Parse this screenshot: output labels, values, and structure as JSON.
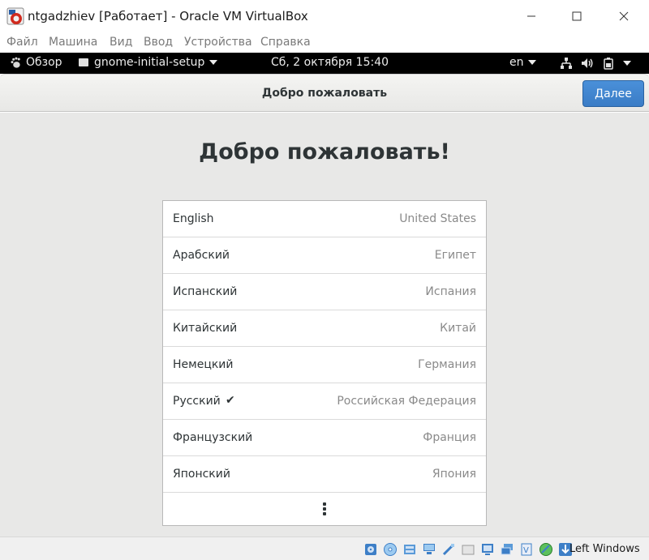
{
  "window": {
    "title": "ntgadzhiev [Работает] - Oracle VM VirtualBox"
  },
  "vbox_menu": {
    "items": [
      "Файл",
      "Машина",
      "Вид",
      "Ввод",
      "Устройства",
      "Справка"
    ]
  },
  "gnome_topbar": {
    "activities_label": "Обзор",
    "app_label": "gnome-initial-setup",
    "clock": "Сб, 2 октября  15:40",
    "input_language": "en"
  },
  "header": {
    "title": "Добро пожаловать",
    "next_label": "Далее",
    "accent_color": "#3a7cc6"
  },
  "main": {
    "welcome_heading": "Добро пожаловать!",
    "languages": [
      {
        "name": "English",
        "region": "United States",
        "selected": false
      },
      {
        "name": "Арабский",
        "region": "Египет",
        "selected": false
      },
      {
        "name": "Испанский",
        "region": "Испания",
        "selected": false
      },
      {
        "name": "Китайский",
        "region": "Китай",
        "selected": false
      },
      {
        "name": "Немецкий",
        "region": "Германия",
        "selected": false
      },
      {
        "name": "Русский",
        "region": "Российская Федерация",
        "selected": true
      },
      {
        "name": "Французский",
        "region": "Франция",
        "selected": false
      },
      {
        "name": "Японский",
        "region": "Япония",
        "selected": false
      }
    ],
    "selected_mark": "✔"
  },
  "vbox_status": {
    "icons": [
      "hard-disk-icon",
      "optical-drive-icon",
      "audio-icon",
      "network-icon",
      "usb-icon",
      "shared-folders-icon",
      "display-icon",
      "video-capture-icon",
      "virtualization-icon",
      "mouse-integration-icon",
      "keyboard-capture-icon"
    ],
    "host_key": "Left Windows"
  }
}
